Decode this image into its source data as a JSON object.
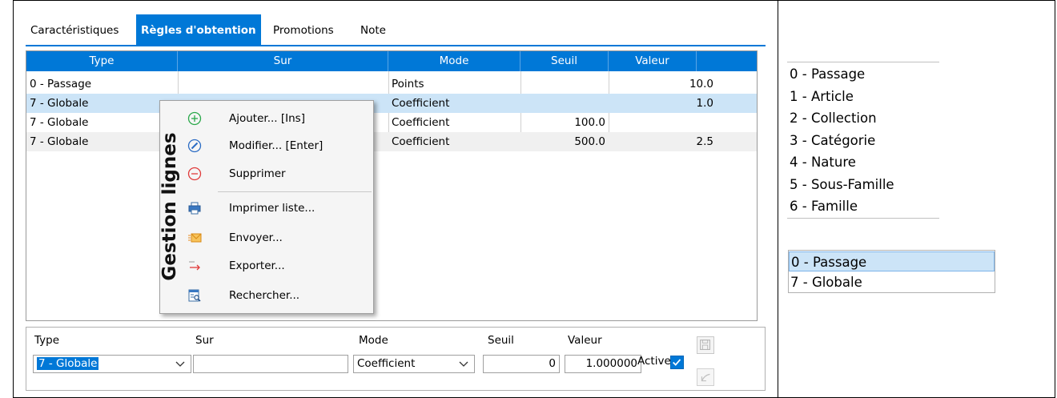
{
  "tabs": [
    {
      "label": "Caractéristiques",
      "active": false
    },
    {
      "label": "Règles d'obtention",
      "active": true
    },
    {
      "label": "Promotions",
      "active": false
    },
    {
      "label": "Note",
      "active": false
    }
  ],
  "grid": {
    "columns": [
      "Type",
      "Sur",
      "Mode",
      "Seuil",
      "Valeur"
    ],
    "rows": [
      {
        "type": "0 - Passage",
        "sur": "",
        "mode": "Points",
        "seuil": "",
        "valeur": "10.0"
      },
      {
        "type": "7 - Globale",
        "sur": "",
        "mode": "Coefficient",
        "seuil": "",
        "valeur": "1.0"
      },
      {
        "type": "7 - Globale",
        "sur": "",
        "mode": "Coefficient",
        "seuil": "100.0",
        "valeur": ""
      },
      {
        "type": "7 - Globale",
        "sur": "",
        "mode": "Coefficient",
        "seuil": "500.0",
        "valeur": "2.5"
      }
    ]
  },
  "context_menu": {
    "side_label": "Gestion lignes",
    "items": [
      {
        "label": "Ajouter... [Ins]",
        "icon": "plus-circle-icon"
      },
      {
        "label": "Modifier... [Enter]",
        "icon": "edit-circle-icon"
      },
      {
        "label": "Supprimer",
        "icon": "minus-circle-icon"
      },
      {
        "label": "Imprimer liste...",
        "icon": "printer-icon"
      },
      {
        "label": "Envoyer...",
        "icon": "envelope-icon"
      },
      {
        "label": "Exporter...",
        "icon": "export-arrow-icon"
      },
      {
        "label": "Rechercher...",
        "icon": "search-document-icon"
      }
    ]
  },
  "form": {
    "type_label": "Type",
    "type_value": "7 - Globale",
    "sur_label": "Sur",
    "sur_value": "",
    "mode_label": "Mode",
    "mode_value": "Coefficient",
    "seuil_label": "Seuil",
    "seuil_value": "0",
    "valeur_label": "Valeur",
    "valeur_value": "1.000000",
    "active_label": "Active",
    "active_checked": true
  },
  "type_list": [
    "0 - Passage",
    "1 - Article",
    "2 - Collection",
    "3 - Catégorie",
    "4 - Nature",
    "5 - Sous-Famille",
    "6 - Famille"
  ],
  "type_dropdown": {
    "items": [
      "0 - Passage",
      "7 - Globale"
    ],
    "selected": "0 - Passage"
  },
  "colors": {
    "accent": "#0078d7",
    "selection": "#cce4f7",
    "alt_row": "#f0f0f0"
  }
}
